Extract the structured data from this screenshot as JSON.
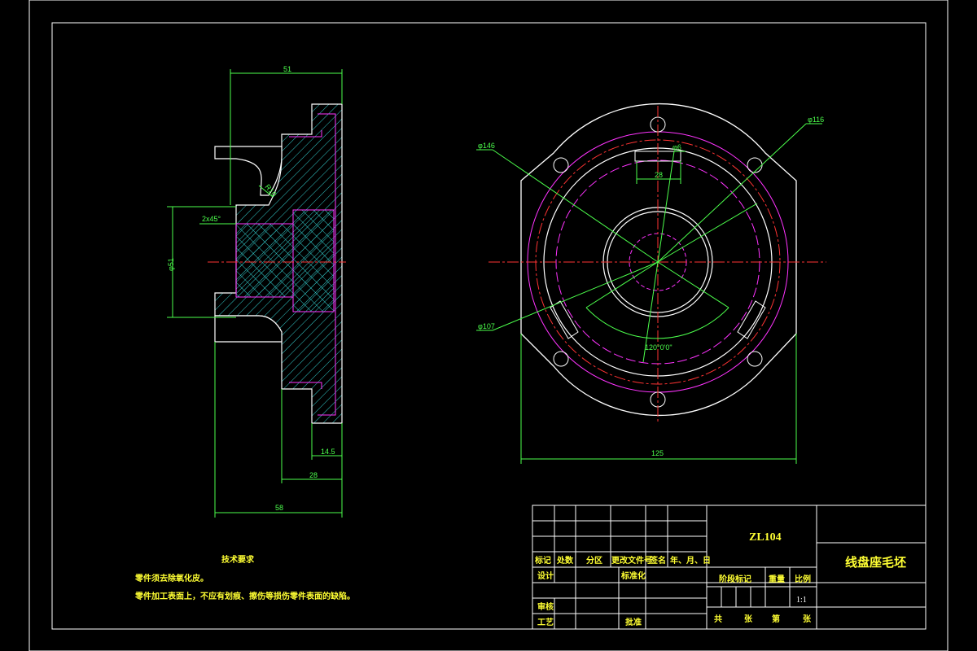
{
  "drawing": {
    "material_code": "ZL104",
    "part_name": "线盘座毛坯",
    "scale": "1:1"
  },
  "dimensions": {
    "section_top_width": "51",
    "section_bottom_width": "58",
    "bottom_28": "28",
    "bottom_14_5": "14.5",
    "diameter_51": "φ51",
    "chamfer": "2x45°",
    "radius": "R10",
    "front_width": "125",
    "dia_116": "φ116",
    "dia_146": "φ146",
    "dia_107": "φ107",
    "dia_6": "φ6",
    "slot_28": "28",
    "angle": "120°0'0\""
  },
  "tech_requirements": {
    "title": "技术要求",
    "line1": "零件须去除氧化皮。",
    "line2": "零件加工表面上，不应有划痕、擦伤等损伤零件表面的缺陷。"
  },
  "title_block": {
    "mark": "标记",
    "count": "处数",
    "zone": "分区",
    "change_doc": "更改文件号",
    "sign": "签名",
    "date": "年、月、日",
    "design": "设计",
    "standardize": "标准化",
    "stage_mark": "阶段标记",
    "weight": "重量",
    "ratio": "比例",
    "review": "审核",
    "process": "工艺",
    "approve": "批准",
    "total": "共",
    "sheets": "张",
    "page": "第",
    "sheet": "张"
  }
}
